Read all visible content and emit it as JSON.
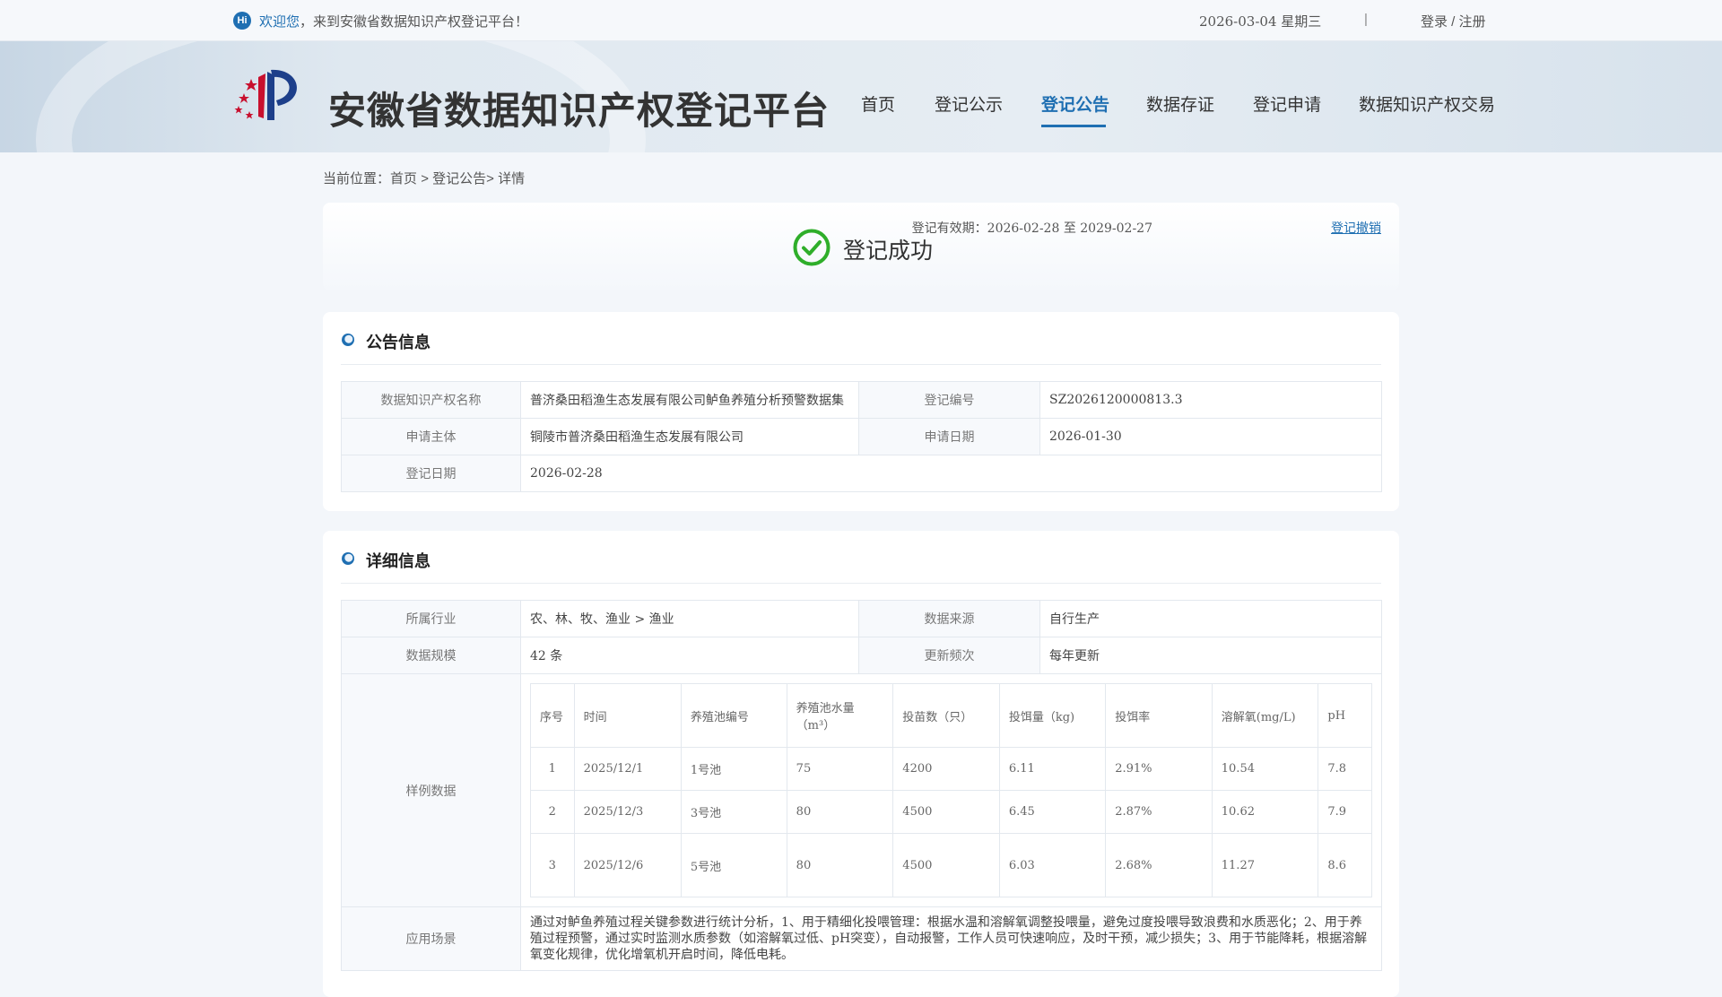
{
  "topbar": {
    "hi": "Hi",
    "welcome_hl": "欢迎您",
    "welcome_rest": "，来到安徽省数据知识产权登记平台！",
    "date": "2026-03-04 星期三",
    "separator": "|",
    "login": "登录 / 注册"
  },
  "header": {
    "title": "安徽省数据知识产权登记平台",
    "nav": [
      "首页",
      "登记公示",
      "登记公告",
      "数据存证",
      "登记申请",
      "数据知识产权交易"
    ],
    "active_index": 2
  },
  "breadcrumb": {
    "prefix": "当前位置：",
    "home": "首页",
    "sep1": " > ",
    "section": "登记公告",
    "sep2": "> ",
    "current": "详情"
  },
  "status": {
    "text": "登记成功",
    "validity": "登记有效期：2026-02-28 至 2029-02-27",
    "revoke": "登记撤销",
    "icon": "check-circle-icon",
    "color": "#2fae2a"
  },
  "announcement": {
    "title": "公告信息",
    "rows": [
      {
        "k1": "数据知识产权名称",
        "v1": "普济桑田稻渔生态发展有限公司鲈鱼养殖分析预警数据集",
        "k2": "登记编号",
        "v2": "SZ2026120000813.3"
      },
      {
        "k1": "申请主体",
        "v1": "铜陵市普济桑田稻渔生态发展有限公司",
        "k2": "申请日期",
        "v2": "2026-01-30"
      },
      {
        "k1": "登记日期",
        "v1": "2026-02-28"
      }
    ]
  },
  "detail": {
    "title": "详细信息",
    "industry_label": "所属行业",
    "industry": "农、林、牧、渔业 > 渔业",
    "source_label": "数据来源",
    "source": "自行生产",
    "scale_label": "数据规模",
    "scale": "42 条",
    "freq_label": "更新频次",
    "freq": "每年更新",
    "sample_label": "样例数据",
    "sample": {
      "headers": [
        "序号",
        "时间",
        "养殖池编号",
        "养殖池水量（m³）",
        "投苗数（只）",
        "投饵量（kg)",
        "投饵率",
        "溶解氧(mg/L)",
        "pH"
      ],
      "rows": [
        [
          "1",
          "2025/12/1",
          "1号池",
          "75",
          "4200",
          "6.11",
          "2.91%",
          "10.54",
          "7.8"
        ],
        [
          "2",
          "2025/12/3",
          "3号池",
          "80",
          "4500",
          "6.45",
          "2.87%",
          "10.62",
          "7.9"
        ],
        [
          "3",
          "2025/12/6",
          "5号池",
          "80",
          "4500",
          "6.03",
          "2.68%",
          "11.27",
          "8.6"
        ]
      ]
    },
    "scene_label": "应用场景",
    "scene": "通过对鲈鱼养殖过程关键参数进行统计分析，1、用于精细化投喂管理：根据水温和溶解氧调整投喂量，避免过度投喂导致浪费和水质恶化；2、用于养殖过程预警，通过实时监测水质参数（如溶解氧过低、pH突变），自动报警，工作人员可快速响应，及时干预，减少损失；3、用于节能降耗，根据溶解氧变化规律，优化增氧机开启时间，降低电耗。"
  },
  "colors": {
    "accent": "#1f6fb2",
    "success": "#2fae2a"
  }
}
